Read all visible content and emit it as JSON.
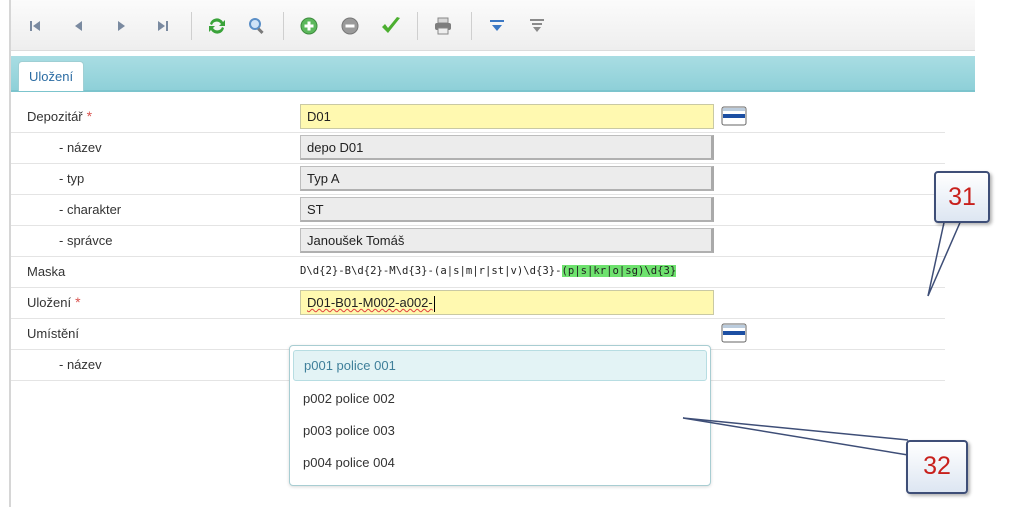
{
  "toolbar": {
    "buttons": [
      {
        "name": "first-record-icon"
      },
      {
        "name": "previous-record-icon"
      },
      {
        "name": "next-record-icon"
      },
      {
        "name": "last-record-icon"
      },
      {
        "name": "refresh-icon"
      },
      {
        "name": "search-icon"
      },
      {
        "name": "add-icon"
      },
      {
        "name": "remove-icon"
      },
      {
        "name": "confirm-icon"
      },
      {
        "name": "print-icon"
      },
      {
        "name": "filter-icon"
      },
      {
        "name": "clear-filter-icon"
      }
    ]
  },
  "tab": {
    "label": "Uložení"
  },
  "form": {
    "depozitar": {
      "label": "Depozitář",
      "value": "D01"
    },
    "nazev": {
      "label": "- název",
      "value": "depo D01"
    },
    "typ": {
      "label": "- typ",
      "value": "Typ A"
    },
    "charakter": {
      "label": "- charakter",
      "value": "ST"
    },
    "spravce": {
      "label": "- správce",
      "value": "Janoušek Tomáš"
    },
    "maska": {
      "label": "Maska",
      "value_main": "D\\d{2}-B\\d{2}-M\\d{3}-(a|s|m|r|st|v)\\d{3}-",
      "value_highlight": "(p|s|kr|o|sg)\\d{3}"
    },
    "ulozeni": {
      "label": "Uložení",
      "value": "D01-B01-M002-a002-"
    },
    "umisteni": {
      "label": "Umístění"
    },
    "umisteni_nazev": {
      "label": "- název"
    },
    "required_mark": "*"
  },
  "dropdown": {
    "options": [
      "p001 police 001",
      "p002 police 002",
      "p003 police 003",
      "p004 police 004"
    ]
  },
  "annotations": {
    "callout_31": "31",
    "callout_32": "32"
  },
  "colors": {
    "accent": "#8ed0d8",
    "highlight_green": "#6ee26e",
    "required": "#d9534f",
    "callout_text": "#c8201c",
    "editable_bg": "#fff9b0"
  }
}
